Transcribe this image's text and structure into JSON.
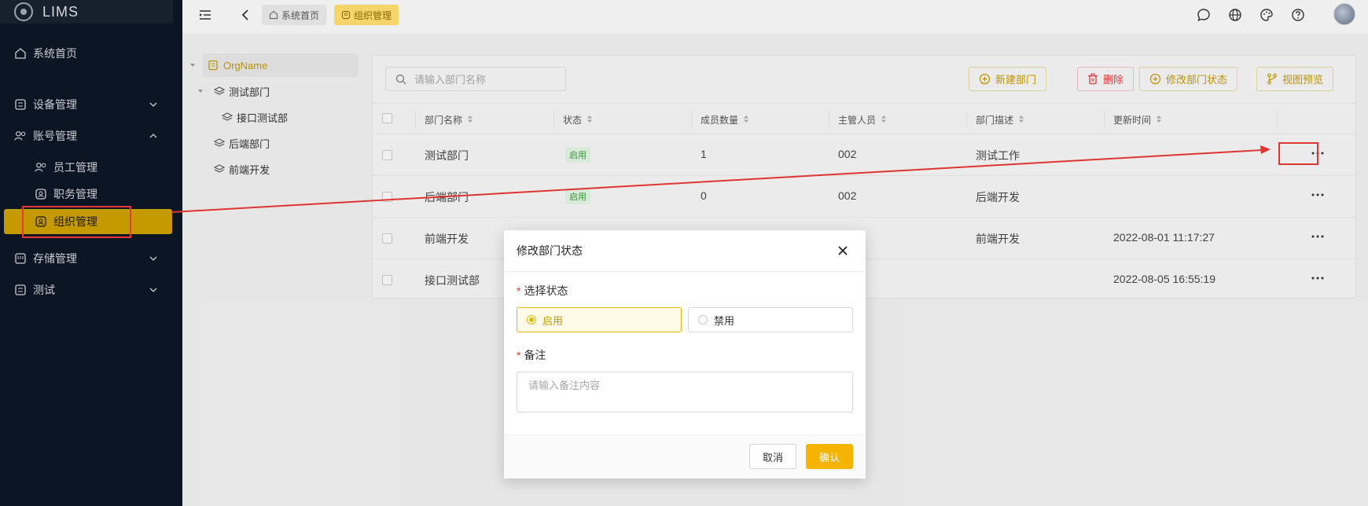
{
  "app": {
    "logo_text": "LIMS"
  },
  "sidebar": {
    "items": [
      {
        "label": "系统首页",
        "icon": "home-icon"
      },
      {
        "label": "设备管理",
        "icon": "table-icon"
      },
      {
        "label": "账号管理",
        "icon": "users-icon"
      },
      {
        "label": "员工管理",
        "icon": "users-icon"
      },
      {
        "label": "职务管理",
        "icon": "badge-icon"
      },
      {
        "label": "组织管理",
        "icon": "badge-icon"
      },
      {
        "label": "存储管理",
        "icon": "storage-icon"
      },
      {
        "label": "测试",
        "icon": "table-icon"
      }
    ]
  },
  "header": {
    "breadcrumbs": [
      {
        "label": "系统首页",
        "icon": "home-icon"
      },
      {
        "label": "组织管理",
        "icon": "badge-icon"
      }
    ]
  },
  "tree": {
    "nodes": [
      {
        "label": "OrgName"
      },
      {
        "label": "测试部门"
      },
      {
        "label": "接口测试部"
      },
      {
        "label": "后端部门"
      },
      {
        "label": "前端开发"
      }
    ]
  },
  "toolbar": {
    "search_placeholder": "请输入部门名称",
    "buttons": [
      {
        "label": "新建部门",
        "icon": "plus-circle-icon"
      },
      {
        "label": "删除",
        "icon": "trash-icon"
      },
      {
        "label": "修改部门状态",
        "icon": "plus-circle-icon"
      },
      {
        "label": "视图预览",
        "icon": "branch-icon"
      }
    ]
  },
  "table": {
    "columns": [
      "部门名称",
      "状态",
      "成员数量",
      "主管人员",
      "部门描述",
      "更新时间"
    ],
    "rows": [
      {
        "name": "测试部门",
        "status": "启用",
        "members": "1",
        "manager": "002",
        "desc": "测试工作",
        "updated": ""
      },
      {
        "name": "后端部门",
        "status": "启用",
        "members": "0",
        "manager": "002",
        "desc": "后端开发",
        "updated": ""
      },
      {
        "name": "前端开发",
        "status": "",
        "members": "",
        "manager": "",
        "desc": "前端开发",
        "updated": "2022-08-01 11:17:27"
      },
      {
        "name": "接口测试部",
        "status": "",
        "members": "",
        "manager": "",
        "desc": "",
        "updated": "2022-08-05 16:55:19"
      }
    ]
  },
  "modal": {
    "title": "修改部门状态",
    "status_label": "选择状态",
    "option_enabled": "启用",
    "option_disabled": "禁用",
    "selected": "启用",
    "remark_label": "备注",
    "remark_placeholder": "请输入备注内容",
    "required_mark": "*",
    "cancel_label": "取消",
    "confirm_label": "确认"
  },
  "colors": {
    "accent": "#c49a00",
    "sidebar_bg": "#0b1523",
    "annotation_red": "#e53935",
    "confirm_button": "#f5b400"
  }
}
